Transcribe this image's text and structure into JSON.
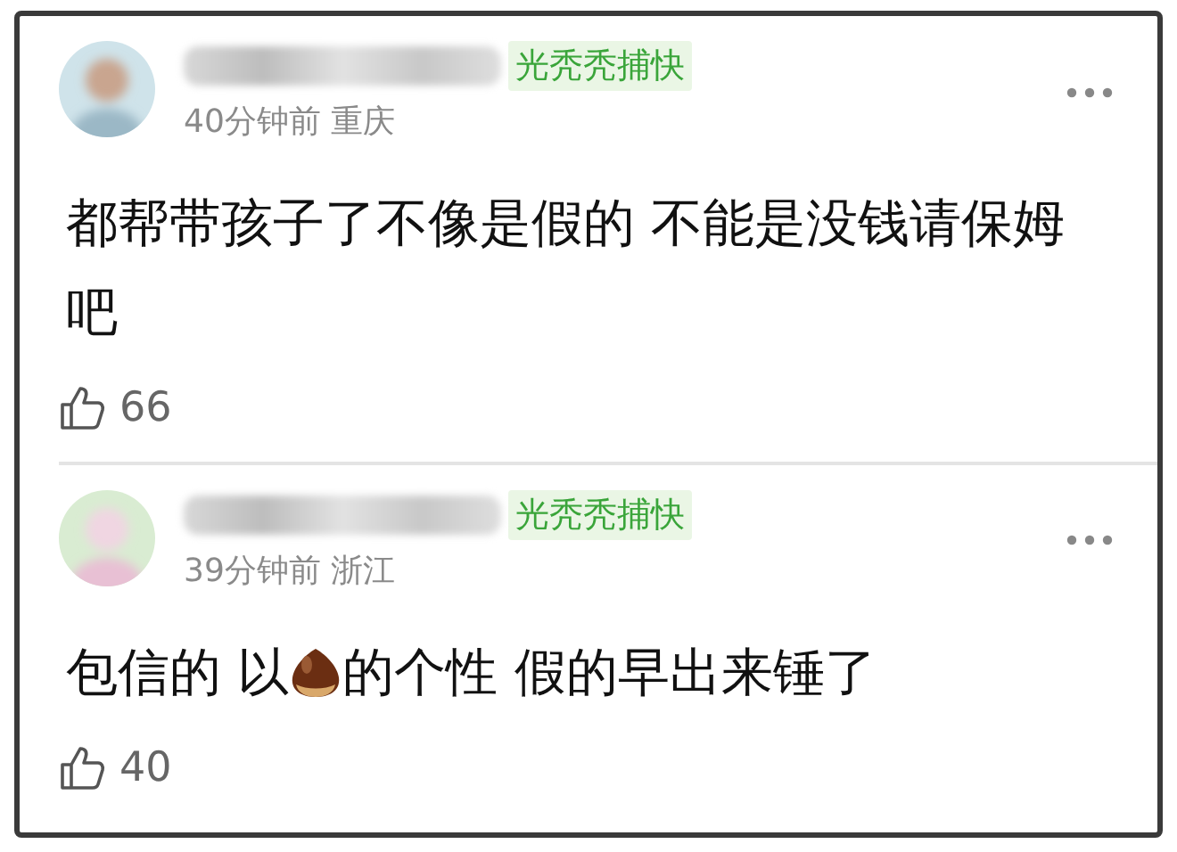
{
  "comments": [
    {
      "tag": "光秃秃捕快",
      "time": "40分钟前",
      "location": "重庆",
      "body": [
        {
          "kind": "text",
          "text": "都帮带孩子了不像是假的 不能是没钱请保姆吧"
        }
      ],
      "likes": "66"
    },
    {
      "tag": "光秃秃捕快",
      "time": "39分钟前",
      "location": "浙江",
      "body": [
        {
          "kind": "text",
          "text": "包信的 以"
        },
        {
          "kind": "emoji"
        },
        {
          "kind": "text",
          "text": "的个性 假的早出来锤了"
        }
      ],
      "likes": "40"
    }
  ]
}
